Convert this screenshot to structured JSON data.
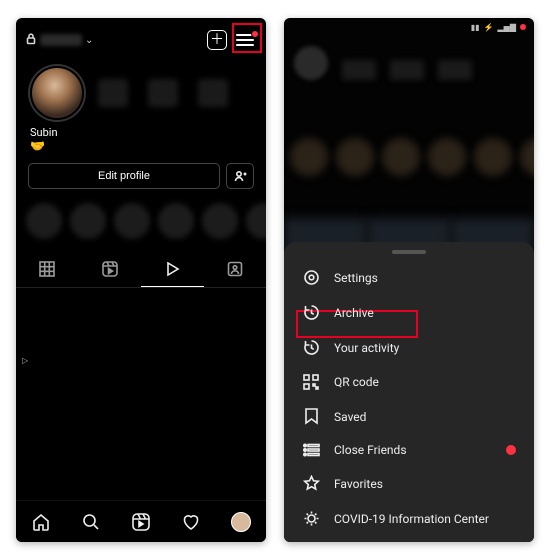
{
  "left": {
    "username": "Subin",
    "emoji": "🤝",
    "edit_profile": "Edit profile",
    "tabs": [
      "grid",
      "reels",
      "play",
      "tagged"
    ]
  },
  "right": {
    "menu": {
      "settings": "Settings",
      "archive": "Archive",
      "your_activity": "Your activity",
      "qr_code": "QR code",
      "saved": "Saved",
      "close_friends": "Close Friends",
      "favorites": "Favorites",
      "covid": "COVID-19 Information Center"
    }
  }
}
